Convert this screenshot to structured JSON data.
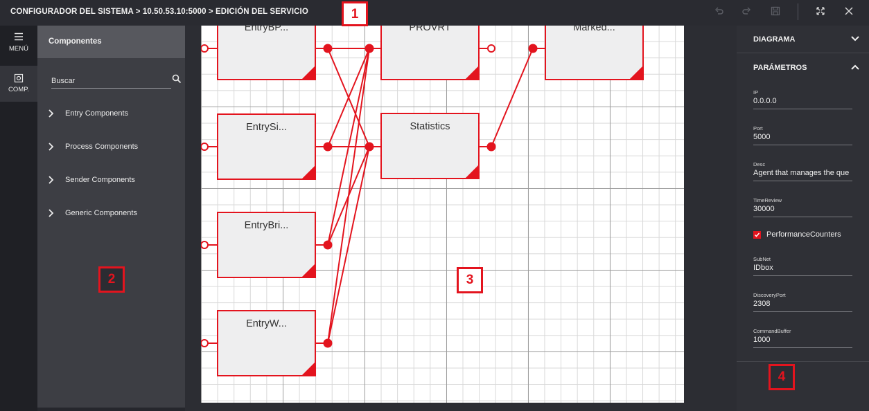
{
  "header": {
    "breadcrumb": "CONFIGURADOR DEL SISTEMA > 10.50.53.10:5000 > EDICIÓN DEL SERVICIO"
  },
  "toolbar_icons": [
    "undo-icon",
    "redo-icon",
    "save-icon",
    "expand-icon",
    "close-icon"
  ],
  "rail": {
    "menu_label": "MENÚ",
    "comp_label": "COMP."
  },
  "components_panel": {
    "title": "Componentes",
    "search_placeholder": "Buscar",
    "categories": [
      {
        "label": "Entry Components"
      },
      {
        "label": "Process Components"
      },
      {
        "label": "Sender Components"
      },
      {
        "label": "Generic Components"
      }
    ]
  },
  "diagram": {
    "nodes": [
      {
        "label": "EntryBP..."
      },
      {
        "label": "EntrySi..."
      },
      {
        "label": "EntryBri..."
      },
      {
        "label": "EntryW..."
      },
      {
        "label": "PROVRT"
      },
      {
        "label": "Statistics"
      },
      {
        "label": "Marked..."
      }
    ]
  },
  "properties": {
    "sections": [
      {
        "label": "DIAGRAMA",
        "expanded": false
      },
      {
        "label": "PARÁMETROS",
        "expanded": true
      }
    ],
    "fields": [
      {
        "label": "IP",
        "value": "0.0.0.0"
      },
      {
        "label": "Port",
        "value": "5000"
      },
      {
        "label": "Desc",
        "value": "Agent that manages the que"
      },
      {
        "label": "TimeReview",
        "value": "30000"
      },
      {
        "label": "SubNet",
        "value": "IDbox"
      },
      {
        "label": "DiscoveryPort",
        "value": "2308"
      },
      {
        "label": "CommandBuffer",
        "value": "1000"
      }
    ],
    "checkbox": {
      "label": "PerformanceCounters",
      "checked": true
    }
  },
  "callouts": [
    "1",
    "2",
    "3",
    "4"
  ],
  "colors": {
    "accent": "#e3141e",
    "topbar": "#2a2b31",
    "panel": "#3d3e44",
    "canvas": "#ffffff"
  }
}
